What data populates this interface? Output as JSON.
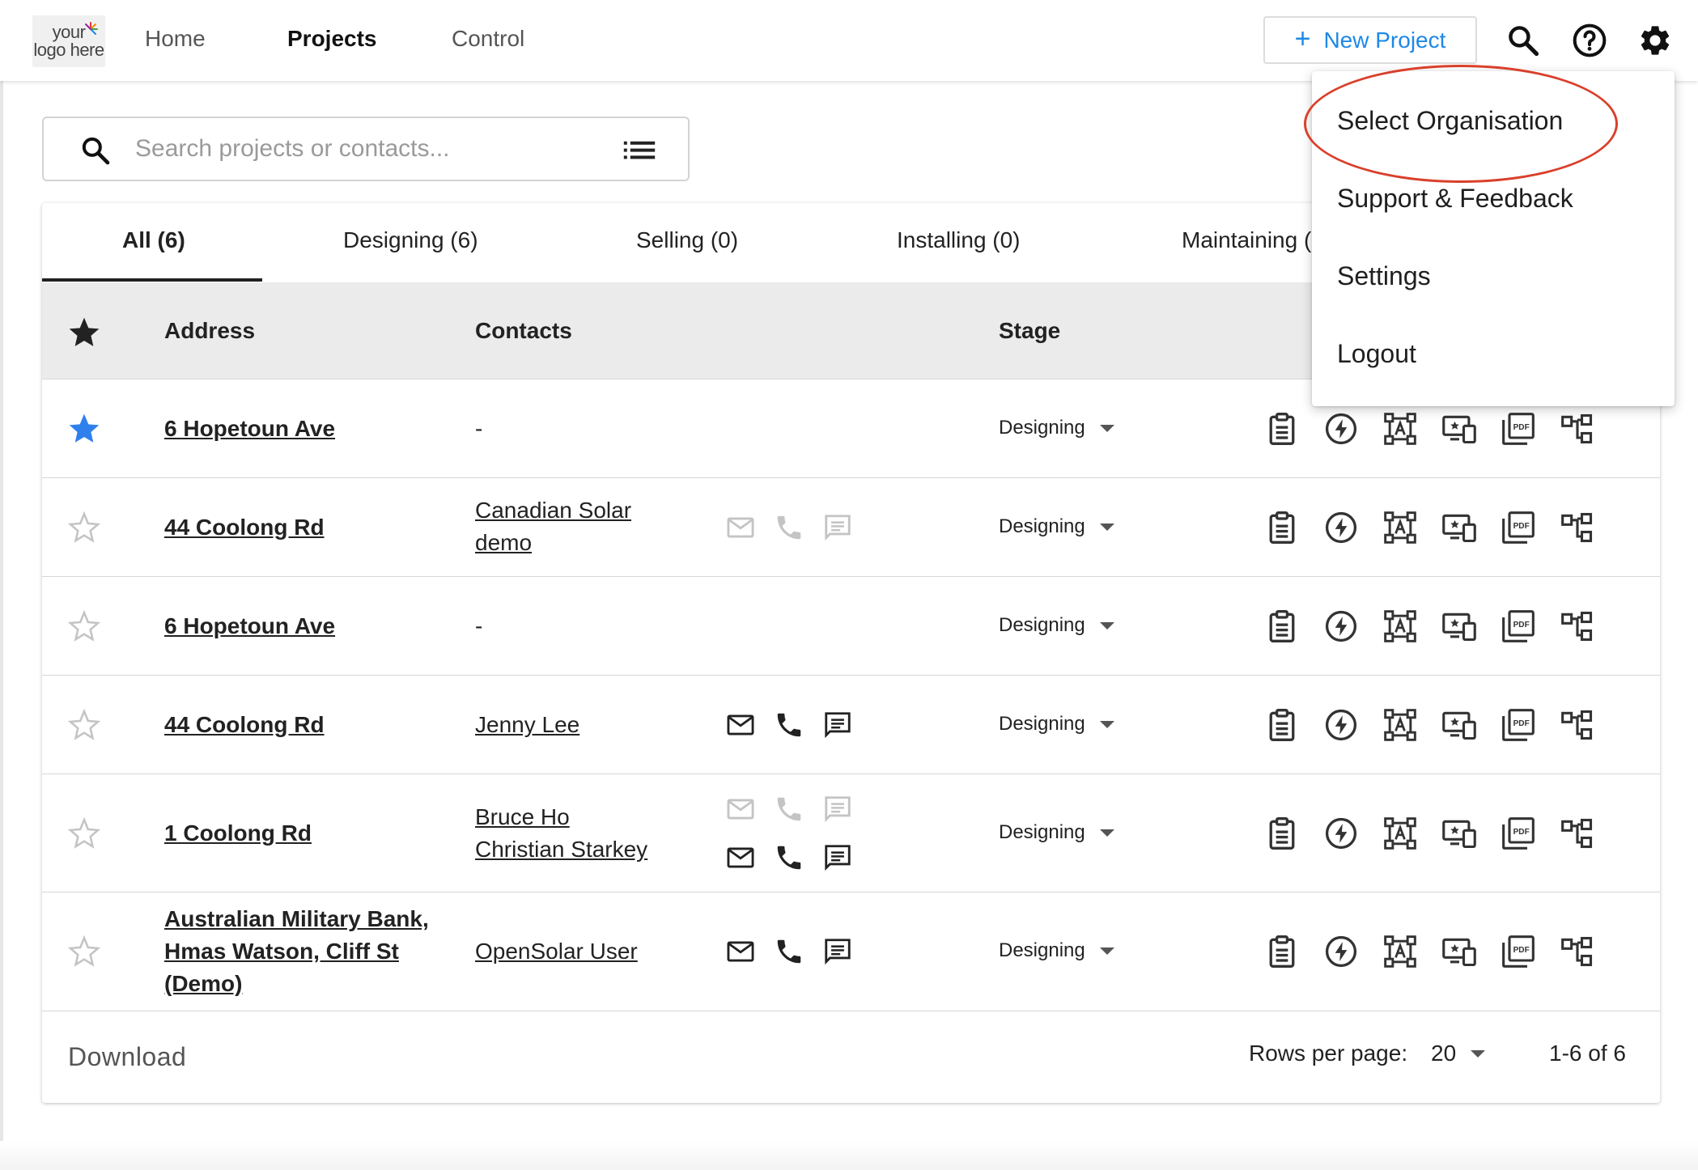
{
  "logo": {
    "line1": "your",
    "line2": "logo here"
  },
  "nav": {
    "home": "Home",
    "projects": "Projects",
    "control": "Control"
  },
  "header": {
    "new_project_plus": "+",
    "new_project_label": "New Project",
    "accent_color": "#1e88e5"
  },
  "search": {
    "placeholder": "Search projects or contacts..."
  },
  "tabs": [
    {
      "label": "All (6)",
      "active": true
    },
    {
      "label": "Designing (6)"
    },
    {
      "label": "Selling (0)"
    },
    {
      "label": "Installing (0)"
    },
    {
      "label": "Maintaining ("
    }
  ],
  "table": {
    "headers": {
      "address": "Address",
      "contacts": "Contacts",
      "stage": "Stage"
    },
    "rows": [
      {
        "starred": true,
        "address": "6 Hopetoun Ave",
        "contacts": [],
        "contacts_dash": "-",
        "stage": "Designing"
      },
      {
        "starred": false,
        "address": "44 Coolong Rd",
        "contacts": [
          "Canadian Solar demo"
        ],
        "stage": "Designing"
      },
      {
        "starred": false,
        "address": "6 Hopetoun Ave",
        "contacts": [],
        "contacts_dash": "-",
        "stage": "Designing"
      },
      {
        "starred": false,
        "address": "44 Coolong Rd",
        "contacts": [
          "Jenny Lee"
        ],
        "stage": "Designing"
      },
      {
        "starred": false,
        "address": "1 Coolong Rd",
        "contacts": [
          "Bruce Ho",
          "Christian Starkey"
        ],
        "stage": "Designing"
      },
      {
        "starred": false,
        "address": "Australian Military Bank, Hmas Watson, Cliff St (Demo)",
        "contacts": [
          "OpenSolar User"
        ],
        "stage": "Designing"
      }
    ]
  },
  "footer": {
    "download": "Download",
    "rows_per_page_label": "Rows per page:",
    "rows_per_page_value": "20",
    "pagination": "1-6 of 6"
  },
  "menu": {
    "items": [
      "Select Organisation",
      "Support & Feedback",
      "Settings",
      "Logout"
    ],
    "highlight_color": "#d9402b"
  }
}
